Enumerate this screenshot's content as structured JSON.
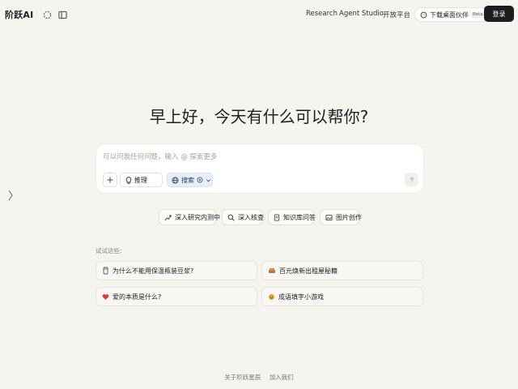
{
  "header": {
    "logo": "阶跃AI",
    "nav": [
      "Research",
      "Agent Studio",
      "开放平台"
    ],
    "download_label": "下载桌面伙伴",
    "download_badge": "Beta",
    "login_label": "登录"
  },
  "greeting": "早上好，今天有什么可以帮你?",
  "input": {
    "placeholder": "可以问我任何问题，输入 @ 探索更多",
    "reason_label": "推理",
    "search_label": "搜索"
  },
  "features": [
    {
      "label": "深入研究内测中",
      "icon": "research-icon"
    },
    {
      "label": "深入核查",
      "icon": "magnifier-icon"
    },
    {
      "label": "知识库问答",
      "icon": "document-icon"
    },
    {
      "label": "图片创作",
      "icon": "image-icon"
    }
  ],
  "try_label": "试试这些:",
  "suggestions": [
    {
      "label": "为什么不能用保温瓶装豆浆?",
      "icon": "cup-icon"
    },
    {
      "label": "百元焕新出租屋秘籍",
      "icon": "sofa-icon"
    },
    {
      "label": "爱的本质是什么?",
      "icon": "heart-icon"
    },
    {
      "label": "成语填字小游戏",
      "icon": "game-icon"
    }
  ],
  "footer": [
    "关于阶跃星辰",
    "加入我们"
  ],
  "colors": {
    "accent": "#1d1d1f",
    "background": "#f5f4ef",
    "search_bg": "#e8eef9"
  }
}
